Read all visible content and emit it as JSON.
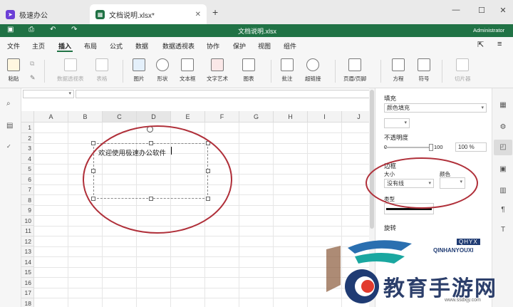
{
  "tabs": [
    {
      "label": "极速办公",
      "icon": "rocket-icon",
      "color": "#6b3fd6"
    },
    {
      "label": "文档说明.xlsx*",
      "icon": "spreadsheet-icon",
      "color": "#207245",
      "active": true
    }
  ],
  "window": {
    "new_tab": "+",
    "minimize": "—",
    "maximize": "☐",
    "close": "✕"
  },
  "title_bar": {
    "document": "文档说明.xlsx",
    "user": "Administrator",
    "accent": "#207245"
  },
  "menu": [
    "文件",
    "主页",
    "插入",
    "布局",
    "公式",
    "数据",
    "数据透视表",
    "协作",
    "保护",
    "视图",
    "组件"
  ],
  "active_menu": "插入",
  "ribbon": [
    {
      "label": "粘贴",
      "icon": "paste-icon",
      "enabled": true
    },
    {
      "label": "数据透视表",
      "icon": "pivot-table-icon",
      "enabled": false
    },
    {
      "label": "表格",
      "icon": "table-icon",
      "enabled": false
    },
    {
      "label": "图片",
      "icon": "image-icon",
      "enabled": true
    },
    {
      "label": "形状",
      "icon": "shape-icon",
      "enabled": true
    },
    {
      "label": "文本框",
      "icon": "textbox-icon",
      "enabled": true
    },
    {
      "label": "文字艺术",
      "icon": "text-art-icon",
      "enabled": true
    },
    {
      "label": "图表",
      "icon": "chart-icon",
      "enabled": true
    },
    {
      "label": "批注",
      "icon": "comment-icon",
      "enabled": true
    },
    {
      "label": "超链接",
      "icon": "hyperlink-icon",
      "enabled": true
    },
    {
      "label": "页眉/页脚",
      "icon": "header-footer-icon",
      "enabled": true
    },
    {
      "label": "方程",
      "icon": "equation-icon",
      "enabled": true
    },
    {
      "label": "符号",
      "icon": "omega-icon",
      "enabled": true
    },
    {
      "label": "切片器",
      "icon": "slicer-icon",
      "enabled": false
    }
  ],
  "columns": [
    "A",
    "B",
    "C",
    "D",
    "E",
    "F",
    "G",
    "H",
    "I",
    "J"
  ],
  "rows": [
    "1",
    "2",
    "3",
    "4",
    "5",
    "6",
    "7",
    "8",
    "9",
    "10",
    "11",
    "12",
    "13",
    "14",
    "15",
    "16",
    "17",
    "18"
  ],
  "textbox": {
    "text": "欢迎使用极速办公软件"
  },
  "panel": {
    "fill_title": "填充",
    "fill_value": "颜色填充",
    "opacity_title": "不透明度",
    "opacity_min": "0",
    "opacity_max": "100",
    "opacity_value": "100 %",
    "opacity_fraction": 1.0,
    "border_title": "边框",
    "size_label": "大小",
    "size_value": "没有线",
    "color_label": "颜色",
    "type_label": "类型",
    "rotate_title": "旋转"
  },
  "watermark": {
    "main": "教育手游网",
    "sub": "QINHANYOUXI",
    "badge": "QHYX",
    "url": "www.ssdxjy.com"
  },
  "annotation_color": "#b0303a"
}
